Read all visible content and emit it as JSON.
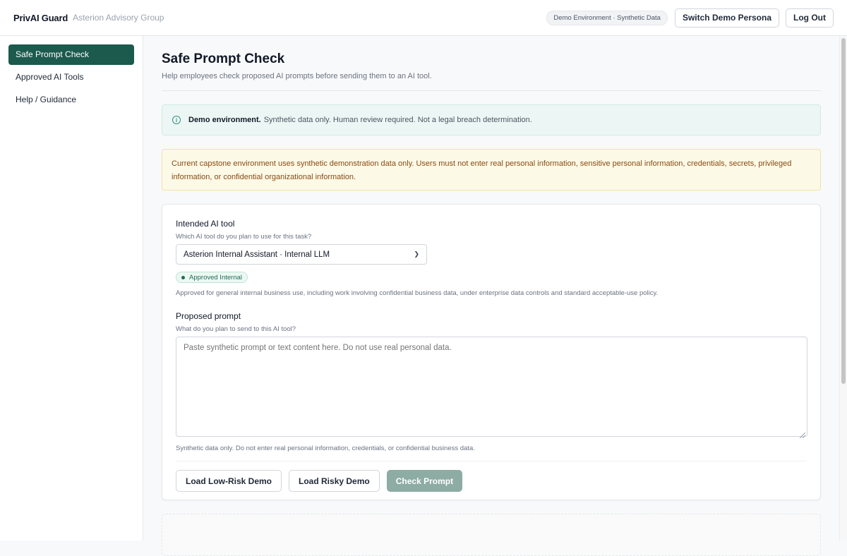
{
  "header": {
    "brand": "PrivAI Guard",
    "org": "Asterion Advisory Group",
    "env_badge": "Demo Environment · Synthetic Data",
    "switch_persona_label": "Switch Demo Persona",
    "logout_label": "Log Out"
  },
  "sidebar": {
    "items": [
      {
        "label": "Safe Prompt Check",
        "active": true
      },
      {
        "label": "Approved AI Tools",
        "active": false
      },
      {
        "label": "Help / Guidance",
        "active": false
      }
    ]
  },
  "main": {
    "title": "Safe Prompt Check",
    "subtitle": "Help employees check proposed AI prompts before sending them to an AI tool.",
    "info_notice": {
      "icon": "info-icon",
      "strong": "Demo environment.",
      "text": "Synthetic data only. Human review required. Not a legal breach determination."
    },
    "warning_notice": "Current capstone environment uses synthetic demonstration data only. Users must not enter real personal information, sensitive personal information, credentials, secrets, privileged information, or confidential organizational information.",
    "form": {
      "tool_label": "Intended AI tool",
      "tool_hint": "Which AI tool do you plan to use for this task?",
      "tool_selected": "Asterion Internal Assistant · Internal LLM",
      "tool_badge": "Approved Internal",
      "tool_description": "Approved for general internal business use, including work involving confidential business data, under enterprise data controls and standard acceptable-use policy.",
      "prompt_label": "Proposed prompt",
      "prompt_hint": "What do you plan to send to this AI tool?",
      "prompt_value": "",
      "prompt_placeholder": "Paste synthetic prompt or text content here. Do not use real personal data.",
      "prompt_footer": "Synthetic data only. Do not enter real personal information, credentials, or confidential business data.",
      "buttons": {
        "low_risk": "Load Low-Risk Demo",
        "risky": "Load Risky Demo",
        "check": "Check Prompt"
      }
    }
  },
  "colors": {
    "accent": "#1b5a4d",
    "badge_green": "#1f6b55",
    "warning_text": "#8a4a0f",
    "disabled_button": "#8daca3"
  }
}
